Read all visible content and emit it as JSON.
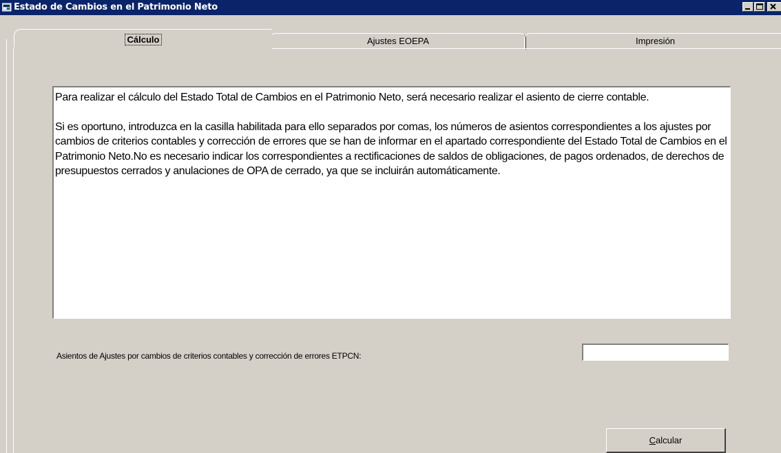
{
  "window": {
    "title": "Estado de Cambios en el Patrimonio Neto",
    "icon": "app-window-icon"
  },
  "tabs": [
    {
      "label": "Cálculo",
      "selected": true
    },
    {
      "label": "Ajustes EOEPA",
      "selected": false
    },
    {
      "label": "Impresión",
      "selected": false
    }
  ],
  "main": {
    "memo_paragraph_1": "Para realizar el cálculo del Estado Total de Cambios en el Patrimonio Neto, será necesario realizar el asiento de cierre contable.",
    "memo_paragraph_2": "Si es oportuno, introduzca en la casilla habilitada para ello separados por comas, los números de asientos correspondientes a los ajustes por cambios de criterios contables y corrección de errores que se han de informar en el apartado correspondiente del Estado Total de Cambios en el Patrimonio Neto.No es necesario indicar los correspondientes a rectificaciones de saldos de obligaciones, de pagos ordenados, de derechos de presupuestos cerrados y anulaciones de OPA de cerrado, ya que se incluirán automáticamente.",
    "field_label": "Asientos de Ajustes por cambios de criterios contables y corrección de errores ETPCN:",
    "field_value": "",
    "button_accel": "C",
    "button_rest": "alcular"
  },
  "colors": {
    "title_bar": "#0a246a",
    "face": "#d4d0c8"
  }
}
